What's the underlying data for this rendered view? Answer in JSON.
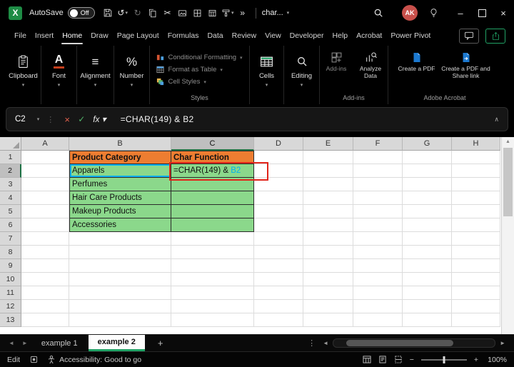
{
  "window": {
    "app": "Excel",
    "doc_name": "char...",
    "autosave_label": "AutoSave",
    "autosave_state": "Off",
    "avatar_initials": "AK",
    "logo_glyph": "X"
  },
  "icons": {
    "undo": "↺",
    "redo": "↻",
    "cut": "✂",
    "caret": "▾",
    "overflow": "»",
    "minimize": "–",
    "close": "×",
    "cancel": "×",
    "check": "✓",
    "dots": "⋮",
    "collapse": "∧",
    "alignment_glyph": "≡",
    "percent_glyph": "%",
    "font_glyph": "A",
    "plus": "+",
    "minus": "−",
    "arrow_left": "◄",
    "arrow_right": "►",
    "triangle_up": "▲"
  },
  "menubar": {
    "items": [
      "File",
      "Insert",
      "Home",
      "Draw",
      "Page Layout",
      "Formulas",
      "Data",
      "Review",
      "View",
      "Developer",
      "Help",
      "Acrobat",
      "Power Pivot"
    ]
  },
  "ribbon": {
    "clipboard_label": "Clipboard",
    "font_label": "Font",
    "alignment_label": "Alignment",
    "number_label": "Number",
    "styles": {
      "group_label": "Styles",
      "items": [
        "Conditional Formatting",
        "Format as Table",
        "Cell Styles"
      ]
    },
    "cells_label": "Cells",
    "editing_label": "Editing",
    "addins": {
      "group_label": "Add-ins",
      "button1": "Add-ins",
      "button2": "Analyze Data"
    },
    "acrobat": {
      "group_label": "Adobe Acrobat",
      "button1": "Create a PDF",
      "button2": "Create a PDF and Share link"
    }
  },
  "formula_bar": {
    "name_box": "C2",
    "fx_label": "fx",
    "formula": "=CHAR(149) & B2"
  },
  "sheet": {
    "col_headers": [
      "A",
      "B",
      "C",
      "D",
      "E",
      "F",
      "G",
      "H"
    ],
    "row_headers": [
      "1",
      "2",
      "3",
      "4",
      "5",
      "6",
      "7",
      "8",
      "9",
      "10",
      "11",
      "12",
      "13"
    ],
    "active_col": "C",
    "active_row": "2",
    "table": {
      "b1": "Product Category",
      "c1": "Char Function",
      "b_values": [
        "Apparels",
        "Perfumes",
        "Hair Care Products",
        "Makeup Products",
        "Accessories"
      ],
      "c2_prefix": "=CHAR(149) & ",
      "c2_ref": "B2"
    }
  },
  "tabs": {
    "items": [
      "example 1",
      "example 2"
    ]
  },
  "statusbar": {
    "mode": "Edit",
    "accessibility": "Accessibility: Good to go",
    "zoom_level": "100%"
  },
  "colors": {
    "accent_green": "#21A366",
    "orange_fill": "#ED7D31",
    "green_fill": "#8BD88B",
    "ref_blue": "#00B0F0",
    "annotation_red": "#E1251B",
    "avatar_red": "#C8504B"
  }
}
